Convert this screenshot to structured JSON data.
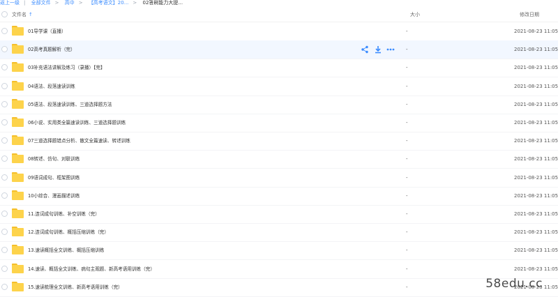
{
  "breadcrumb": {
    "back": "返上一级",
    "all": "全部文件",
    "level1": "高中",
    "level2": "【高考语文】20...",
    "current": "02答刷能力大提..."
  },
  "columns": {
    "name": "文件名",
    "size": "大小",
    "time": "修改日期"
  },
  "rows": [
    {
      "name": "01导学课（直播）",
      "size": "-",
      "time": "2021-08-23 11:05"
    },
    {
      "name": "02高考真题解析（完）",
      "size": "-",
      "time": "2021-08-23 11:05"
    },
    {
      "name": "03补充语法讲解及练习（录播）【完】",
      "size": "-",
      "time": "2021-08-23 11:05"
    },
    {
      "name": "04语法、段落速读训练",
      "size": "-",
      "time": "2021-08-23 11:05"
    },
    {
      "name": "05语法、段落速读训练、三道选择题方法",
      "size": "-",
      "time": "2021-08-23 11:05"
    },
    {
      "name": "06小说、实用类全篇速读训练、三道选择题训练",
      "size": "-",
      "time": "2021-08-23 11:05"
    },
    {
      "name": "07三道选择题错点分析、散文全篇速读、转述训练",
      "size": "-",
      "time": "2021-08-23 11:05"
    },
    {
      "name": "08转述、仿句、对联训练",
      "size": "-",
      "time": "2021-08-23 11:05"
    },
    {
      "name": "09语词成句、框架图训练",
      "size": "-",
      "time": "2021-08-23 11:05"
    },
    {
      "name": "10小综合、漫画描述训练",
      "size": "-",
      "time": "2021-08-23 11:05"
    },
    {
      "name": "11.连词成句训练、补空训练（完）",
      "size": "-",
      "time": "2021-08-23 11:05"
    },
    {
      "name": "12.连词成句训练、概括压缩训练（完）",
      "size": "-",
      "time": "2021-08-23 11:05"
    },
    {
      "name": "13.速读概括全文训练、概括压缩训练",
      "size": "-",
      "time": "2021-08-23 11:05"
    },
    {
      "name": "14.速读、概括全文训练、病句主观题、新高考语用训练（完）",
      "size": "-",
      "time": "2021-08-23 11:05"
    },
    {
      "name": "15.速读梳理全文训练、新高考语用训练（完）",
      "size": "-",
      "time": "2021-08-23 11:05"
    }
  ],
  "row_actions": [
    "share-icon",
    "download-icon",
    "more-icon"
  ],
  "watermark": "58edu.cc",
  "colors": {
    "accent": "#3b8cff",
    "folder": "#fdd34b",
    "active_row": "#f2f7ff"
  }
}
